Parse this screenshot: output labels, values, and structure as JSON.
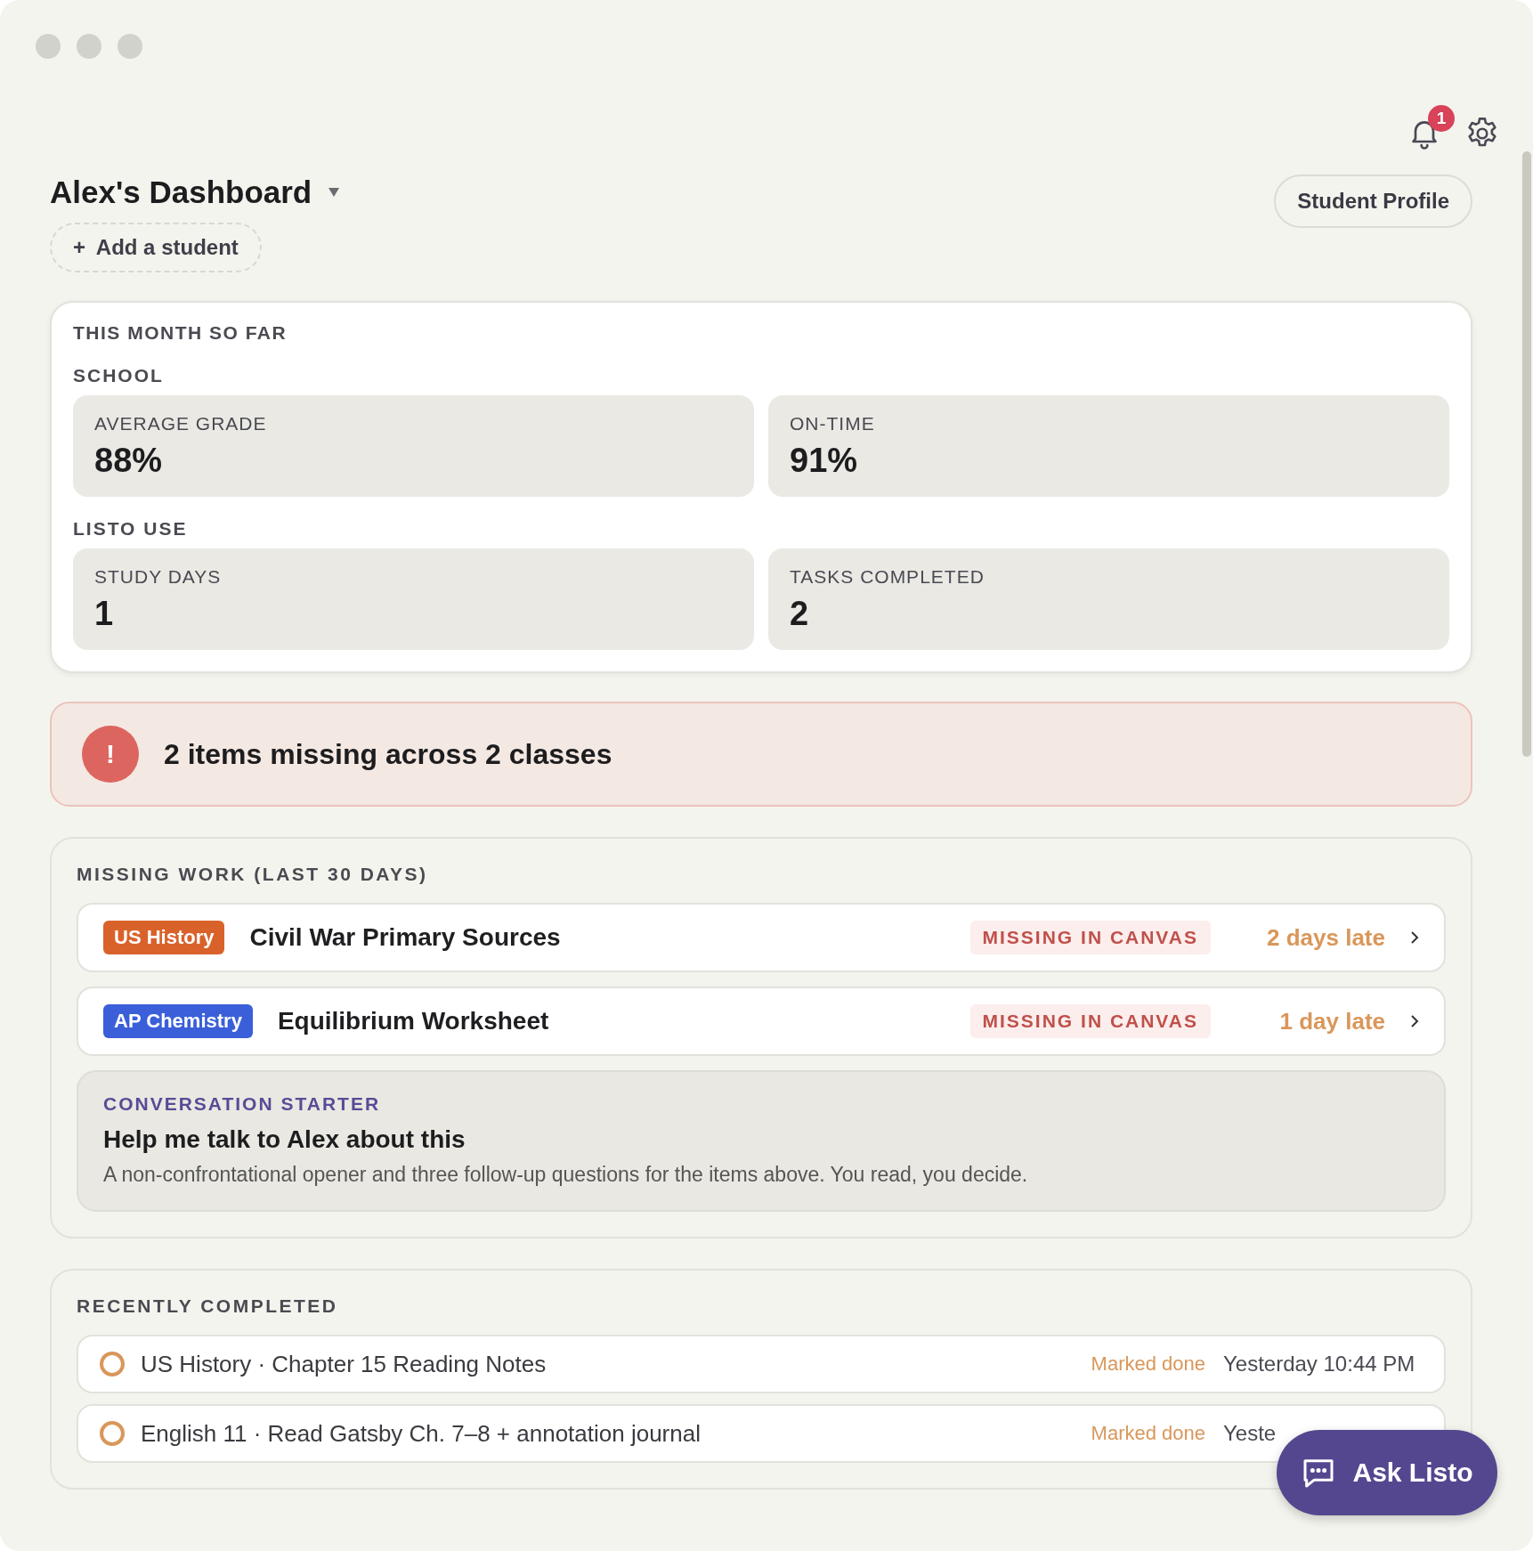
{
  "header": {
    "notification_count": "1",
    "title": "Alex's Dashboard",
    "profile_button": "Student Profile",
    "add_student": "Add a student",
    "add_icon": "+"
  },
  "stats": {
    "title": "THIS MONTH SO FAR",
    "groups": [
      {
        "label": "SCHOOL",
        "cards": [
          {
            "label": "AVERAGE GRADE",
            "value": "88%"
          },
          {
            "label": "ON-TIME",
            "value": "91%"
          }
        ]
      },
      {
        "label": "LISTO USE",
        "cards": [
          {
            "label": "STUDY DAYS",
            "value": "1"
          },
          {
            "label": "TASKS COMPLETED",
            "value": "2"
          }
        ]
      }
    ]
  },
  "alert": {
    "icon": "!",
    "text": "2 items missing across 2 classes"
  },
  "missing_work": {
    "title": "MISSING WORK (LAST 30 DAYS)",
    "items": [
      {
        "class": "US History",
        "color": "#d9622b",
        "title": "Civil War Primary Sources",
        "status": "MISSING IN CANVAS",
        "late": "2 days late"
      },
      {
        "class": "AP Chemistry",
        "color": "#3a5fd9",
        "title": "Equilibrium Worksheet",
        "status": "MISSING IN CANVAS",
        "late": "1 day late"
      }
    ],
    "starter": {
      "label": "CONVERSATION STARTER",
      "title": "Help me talk to Alex about this",
      "text": "A non-confrontational opener and three follow-up questions for the items above. You read, you decide."
    }
  },
  "recently_completed": {
    "title": "RECENTLY COMPLETED",
    "items": [
      {
        "text": "US History · Chapter 15 Reading Notes",
        "status": "Marked done",
        "time": "Yesterday 10:44 PM"
      },
      {
        "text": "English 11 · Read Gatsby Ch. 7–8 + annotation journal",
        "status": "Marked done",
        "time": "Yeste"
      }
    ]
  },
  "ask_button": "Ask Listo"
}
